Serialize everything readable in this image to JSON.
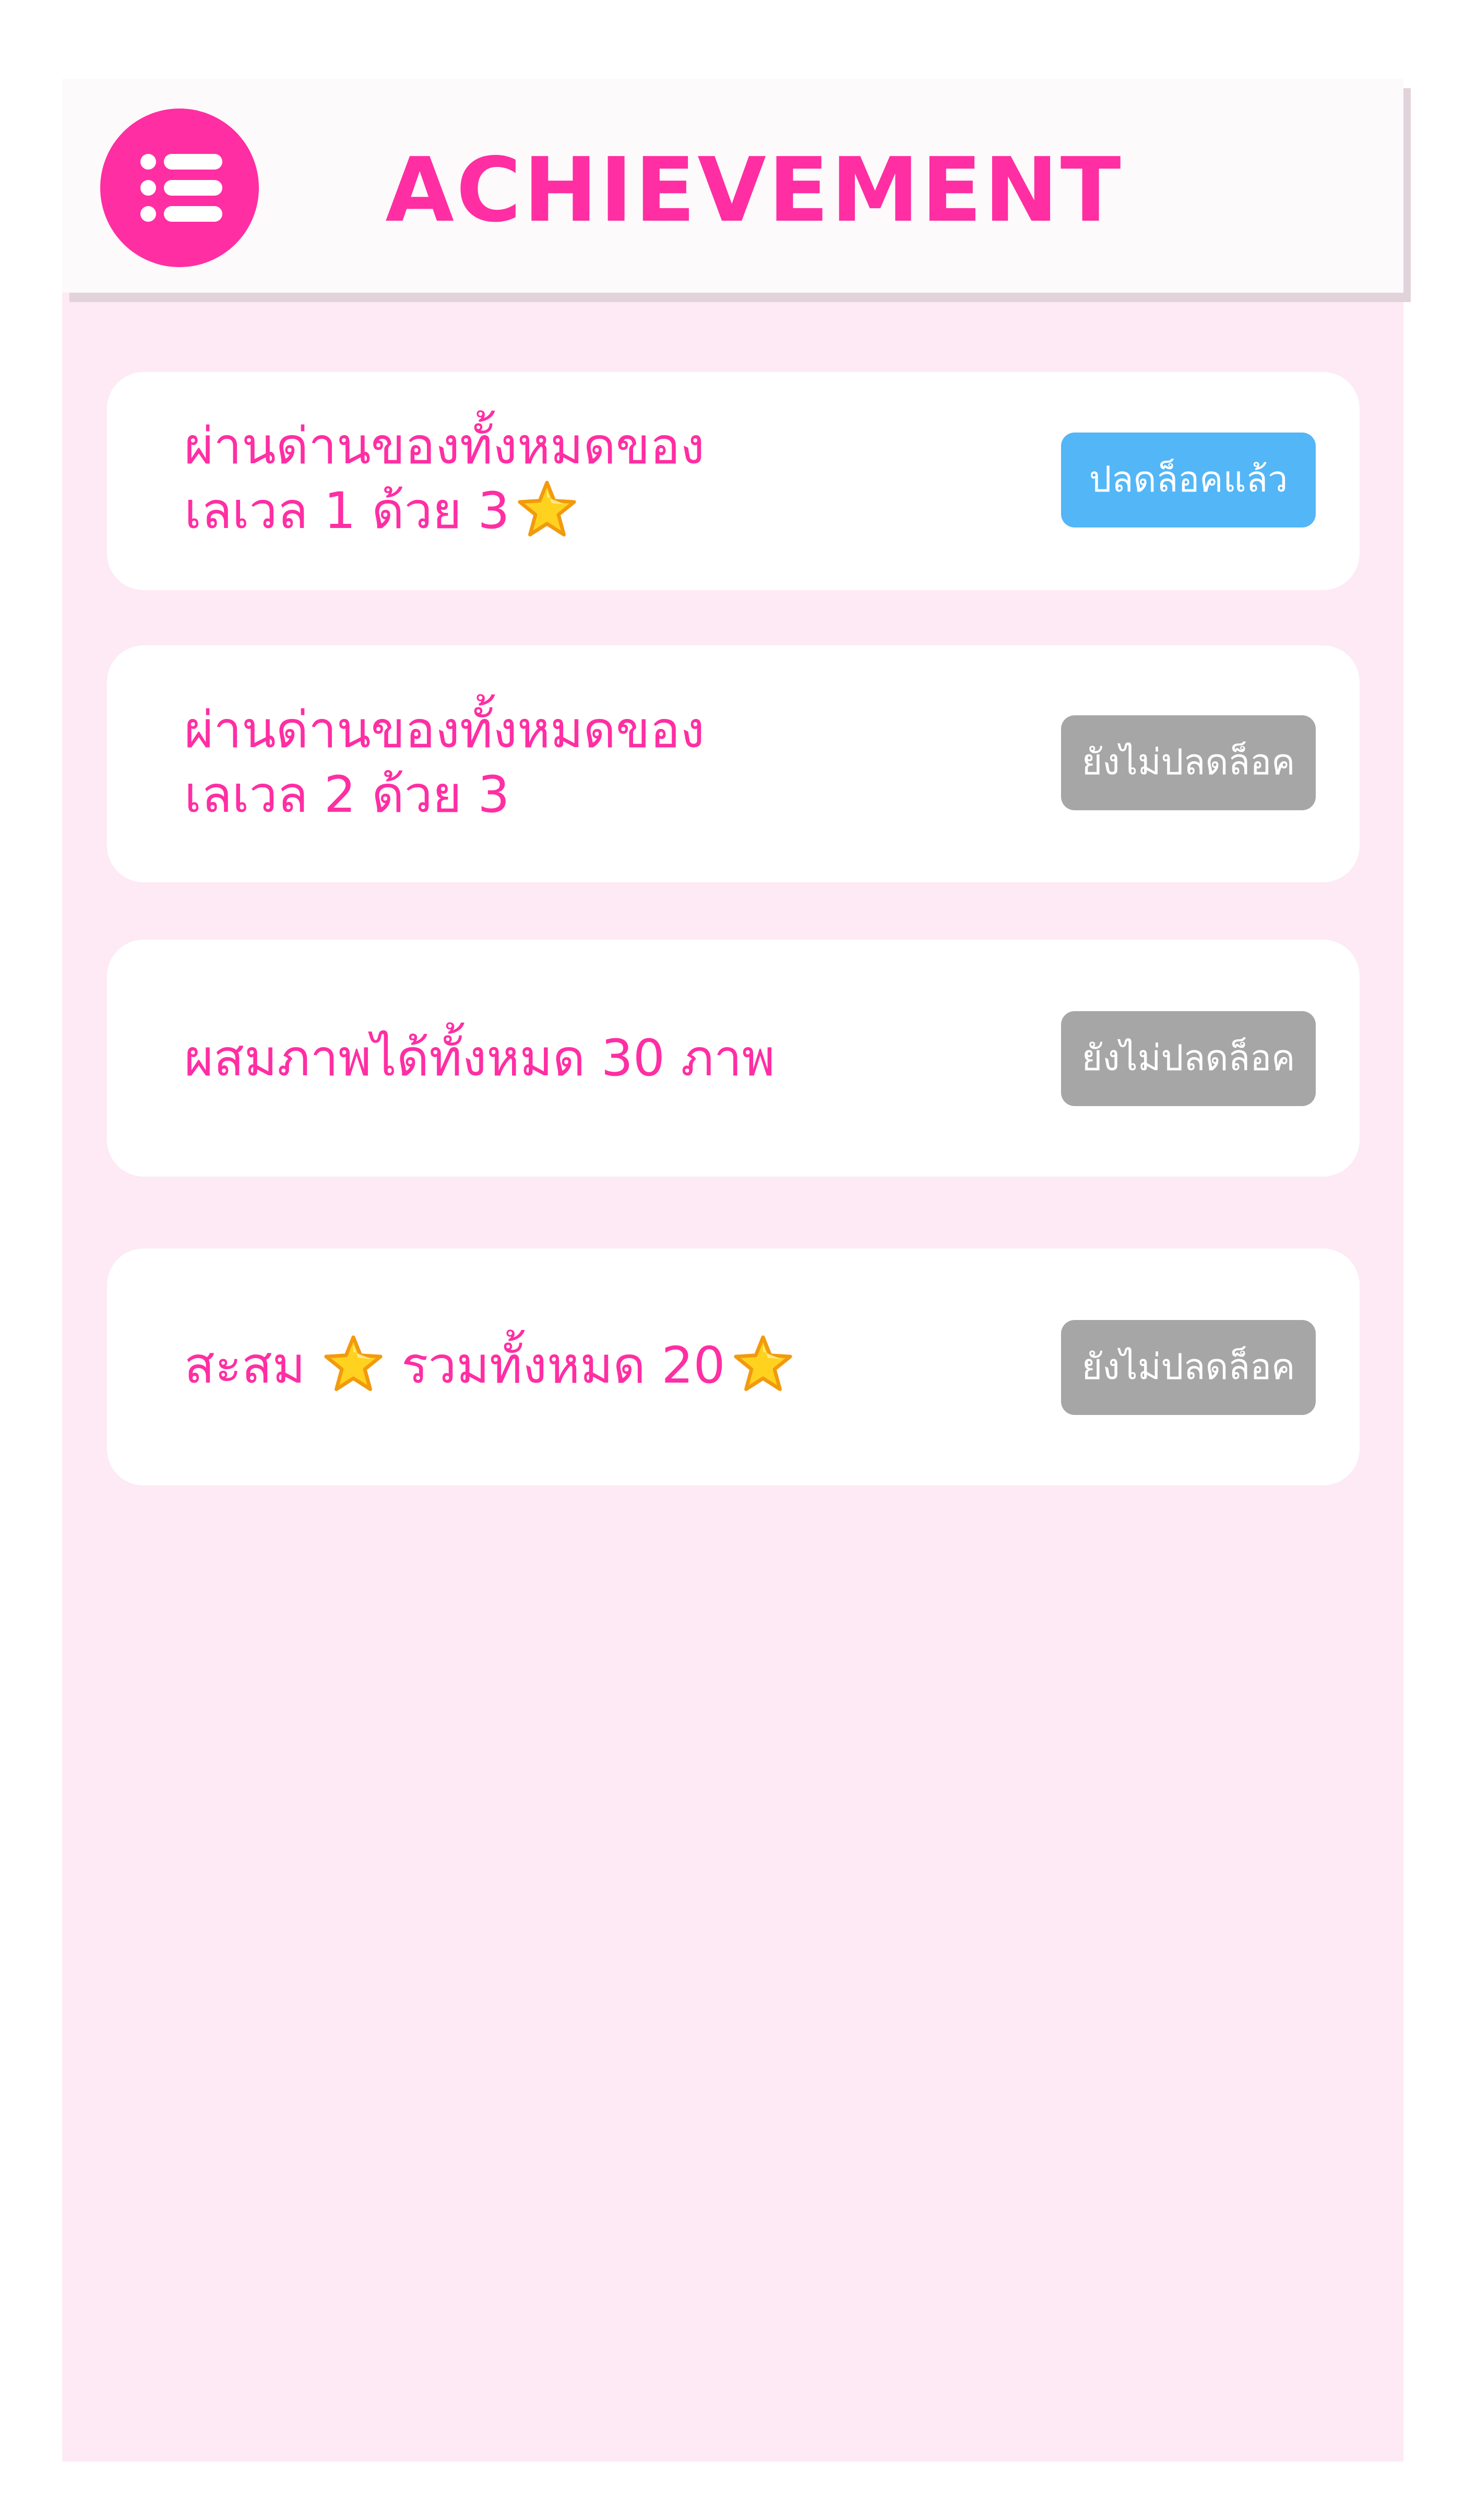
{
  "header": {
    "title": "ACHIEVEMENT",
    "menu_icon": "list-menu-icon"
  },
  "colors": {
    "accent": "#ff2ea3",
    "background": "#fdeaf4",
    "unlocked_badge": "#53b6f7",
    "locked_badge": "#a6a6a6"
  },
  "achievements": [
    {
      "line1": "ผ่านด่านของทั้งหมดของ",
      "line2": "เลเวล 1  ด้วย   3",
      "status": "ปลดล็อคแล้ว",
      "unlocked": true,
      "icon": "star-icon"
    },
    {
      "line1": "ผ่านด่านของทั้งหมดของ",
      "line2": "เลเวล 2  ด้วย   3",
      "status": "ยังไม่ปลดล็อค",
      "unlocked": false
    },
    {
      "line1": "ผสมภาพได้ทั้งหมด 30 ภาพ",
      "status": "ยังไม่ปลดล็อค",
      "unlocked": false
    },
    {
      "part1": "สะสม",
      "part2": "รวมทั้งหมด 20",
      "status": "ยังไม่ปลดล็อค",
      "unlocked": false,
      "icon": "star-icon"
    }
  ]
}
